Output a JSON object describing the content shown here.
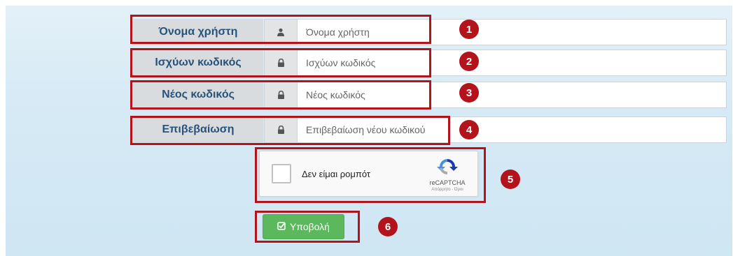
{
  "form": {
    "fields": [
      {
        "label": "Όνομα χρήστη",
        "icon": "user-icon",
        "placeholder": "Όνομα χρήστη",
        "value": ""
      },
      {
        "label": "Ισχύων κωδικός",
        "icon": "lock-icon",
        "placeholder": "Ισχύων κωδικός",
        "value": ""
      },
      {
        "label": "Νέος κωδικός",
        "icon": "lock-icon",
        "placeholder": "Νέος κωδικός",
        "value": ""
      },
      {
        "label": "Επιβεβαίωση",
        "icon": "lock-icon",
        "placeholder": "Επιβεβαίωση νέου κωδικού",
        "value": ""
      }
    ],
    "captcha": {
      "label": "Δεν είμαι ρομπότ",
      "brand": "reCAPTCHA",
      "terms": "Απόρρητο - Όροι",
      "icon": "recaptcha-logo-icon"
    },
    "submit": {
      "label": "Υποβολή",
      "icon": "check-square-icon"
    }
  },
  "annotations": [
    "1",
    "2",
    "3",
    "4",
    "5",
    "6"
  ],
  "colors": {
    "highlight": "#b3141c",
    "label_text": "#29527a",
    "submit_bg": "#5cb85c",
    "panel_bg": "#d6eaf5"
  }
}
